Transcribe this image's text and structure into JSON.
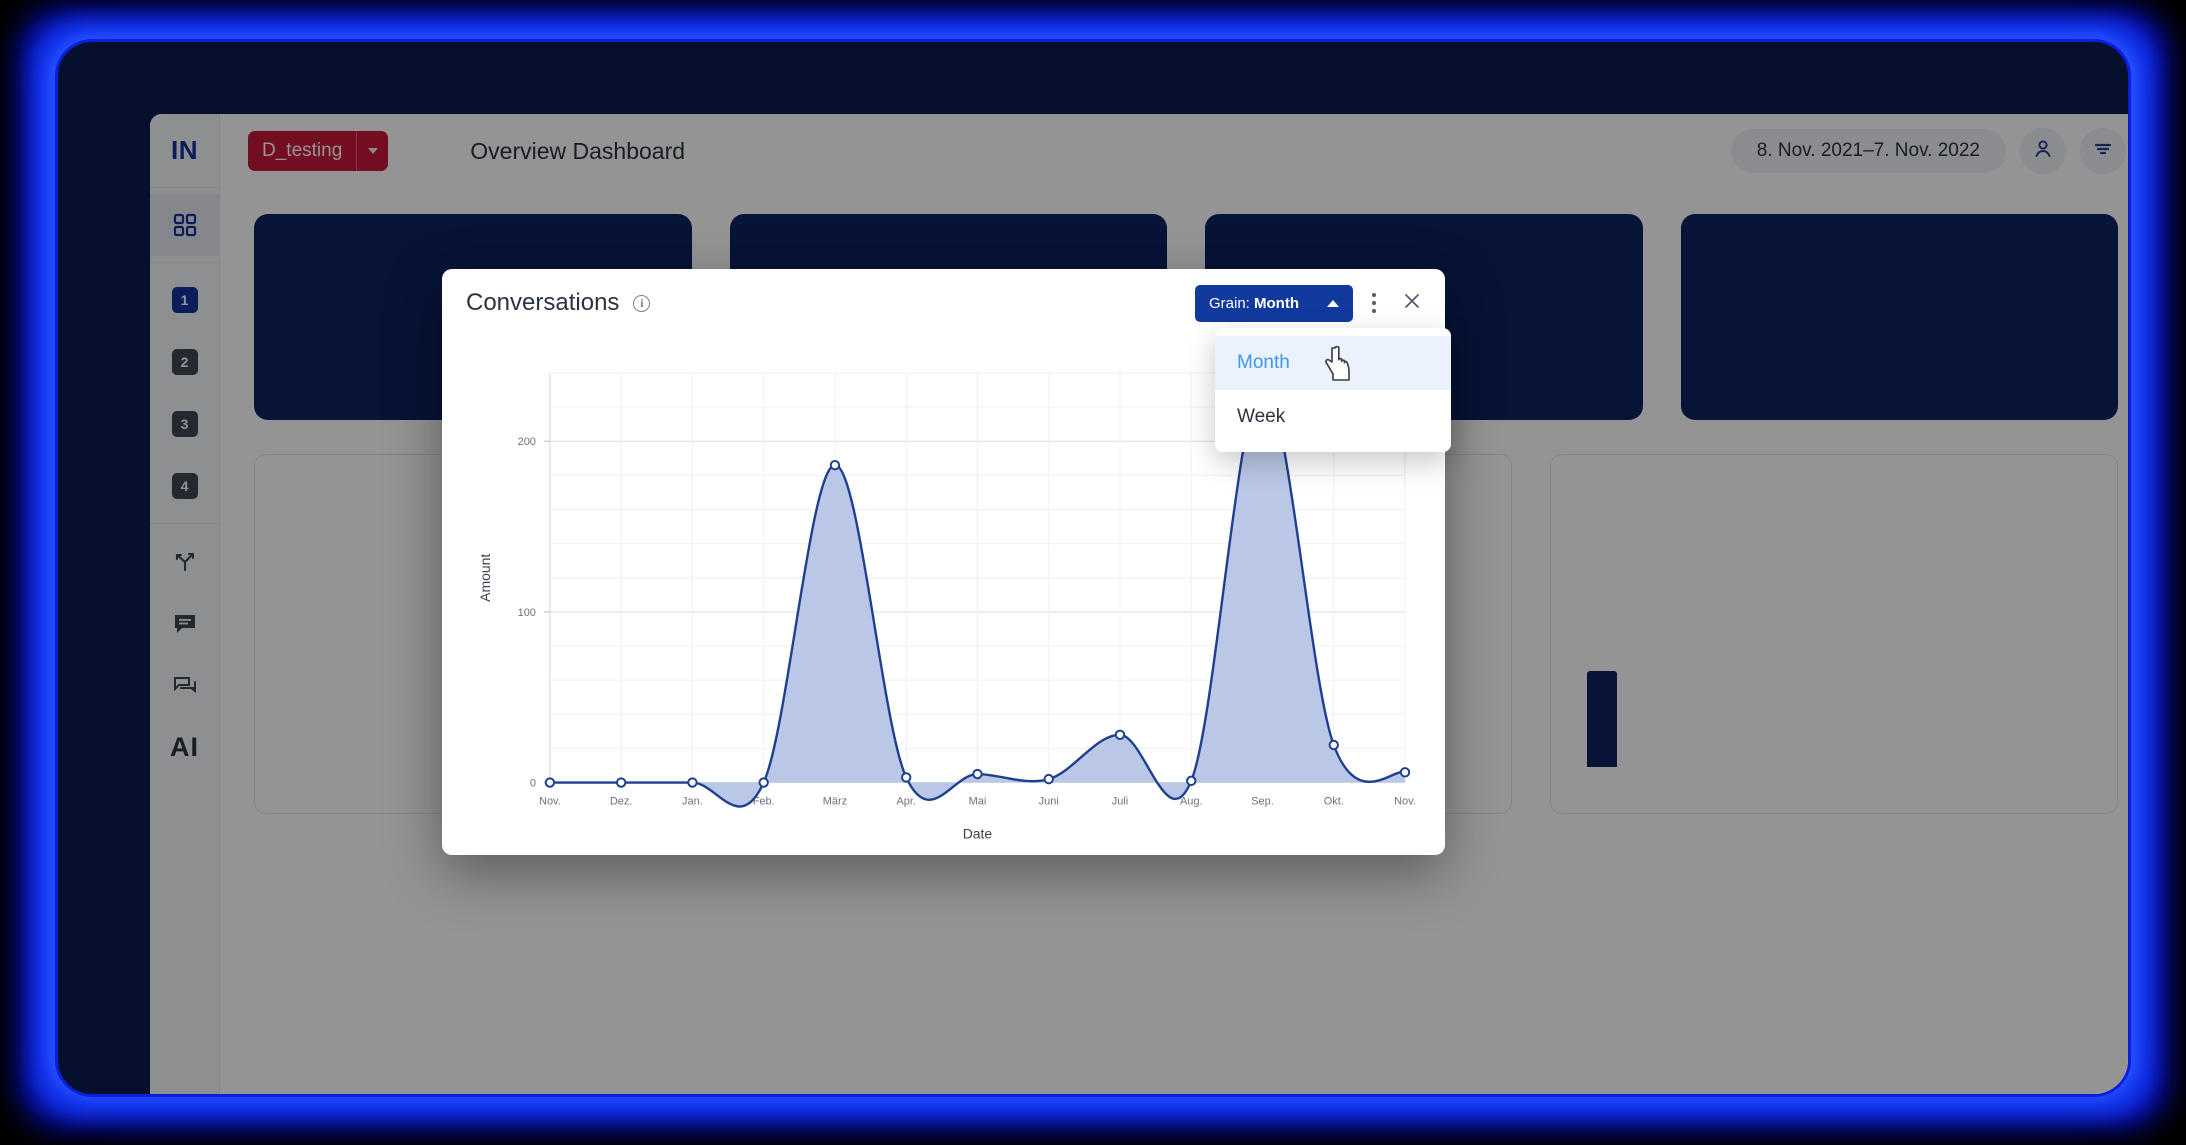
{
  "app": {
    "logo_text": "IN",
    "page_title": "Overview Dashboard"
  },
  "topbar": {
    "tenant_label": "D_testing",
    "date_range": "8. Nov. 2021–7. Nov. 2022",
    "profile_icon": "person-icon",
    "filter_icon": "filter-icon"
  },
  "sidebar": {
    "items": [
      {
        "name": "grid-icon",
        "label": "",
        "type": "icon",
        "active": true
      },
      {
        "name": "step-1-badge",
        "label": "1",
        "type": "badge",
        "active": true
      },
      {
        "name": "step-2-badge",
        "label": "2",
        "type": "badge",
        "active": false
      },
      {
        "name": "step-3-badge",
        "label": "3",
        "type": "badge",
        "active": false
      },
      {
        "name": "step-4-badge",
        "label": "4",
        "type": "badge",
        "active": false
      },
      {
        "name": "branch-icon",
        "label": "",
        "type": "icon",
        "active": false
      },
      {
        "name": "chat-bubble-icon",
        "label": "",
        "type": "icon",
        "active": false
      },
      {
        "name": "conversation-icon",
        "label": "",
        "type": "icon",
        "active": false
      },
      {
        "name": "ai-logo",
        "label": "AI",
        "type": "text",
        "active": false
      }
    ]
  },
  "modal": {
    "title": "Conversations",
    "info_icon": "info-icon",
    "grain_button": {
      "prefix": "Grain: ",
      "value": "Month",
      "caret": "chevron-up-icon"
    },
    "menu_icon": "kebab-menu-icon",
    "close_icon": "close-icon",
    "dropdown": {
      "options": [
        {
          "label": "Month",
          "selected": true
        },
        {
          "label": "Week",
          "selected": false
        }
      ]
    }
  },
  "chart_data": {
    "type": "area",
    "title": "Conversations",
    "xlabel": "Date",
    "ylabel": "Amount",
    "categories": [
      "Nov.",
      "Dez.",
      "Jan.",
      "Feb.",
      "März",
      "Apr.",
      "Mai",
      "Juni",
      "Juli",
      "Aug.",
      "Sep.",
      "Okt.",
      "Nov."
    ],
    "values": [
      0,
      0,
      0,
      0,
      186,
      3,
      5,
      2,
      28,
      1,
      232,
      22,
      6
    ],
    "ylim": [
      0,
      240
    ],
    "yticks": [
      0,
      100,
      200
    ],
    "ytick_labels": [
      "0",
      "100",
      "200"
    ],
    "grid": true,
    "gridline_step": 20,
    "legend": "none",
    "line_color": "#1f3f8f",
    "fill_color": "#b6c4e6",
    "marker": "open-circle"
  },
  "colors": {
    "brand_blue": "#123a9e",
    "tenant_red": "#c4183c",
    "card_navy": "#0d2260",
    "accent_light_blue": "#3f96f3"
  }
}
